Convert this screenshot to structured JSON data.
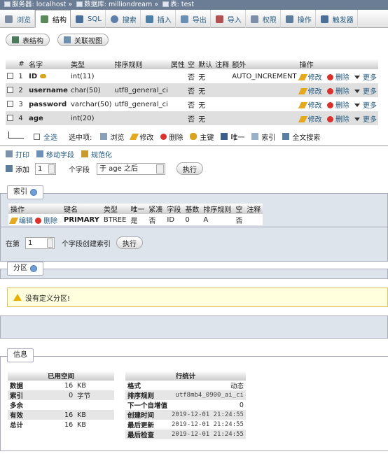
{
  "breadcrumb": {
    "server_label": "服务器:",
    "server": "localhost",
    "db_label": "数据库:",
    "db": "milliondream",
    "table_label": "表:",
    "table": "test",
    "sep": "»"
  },
  "tabs": [
    {
      "label": "浏览",
      "color": "#7d8ca3"
    },
    {
      "label": "结构",
      "color": "#5a8a5a"
    },
    {
      "label": "SQL",
      "color": "#4a6f9a"
    },
    {
      "label": "搜索",
      "color": "#5d7fa8"
    },
    {
      "label": "插入",
      "color": "#4d80a6"
    },
    {
      "label": "导出",
      "color": "#6a8fb5"
    },
    {
      "label": "导入",
      "color": "#b05050"
    },
    {
      "label": "权限",
      "color": "#7f8ea8"
    },
    {
      "label": "操作",
      "color": "#5c7d9c"
    },
    {
      "label": "触发器",
      "color": "#4b6f96"
    }
  ],
  "view_buttons": {
    "table_structure": "表结构",
    "relation_view": "关联视图"
  },
  "columns_header": [
    "#",
    "名字",
    "类型",
    "排序规则",
    "属性",
    "空",
    "默认",
    "注释",
    "额外",
    "操作"
  ],
  "columns": [
    {
      "num": "1",
      "name": "ID",
      "type": "int(11)",
      "collation": "",
      "attr": "",
      "null": "否",
      "default": "无",
      "comment": "",
      "extra": "AUTO_INCREMENT",
      "key_icon": "key-icon"
    },
    {
      "num": "2",
      "name": "username",
      "type": "char(50)",
      "collation": "utf8_general_ci",
      "attr": "",
      "null": "否",
      "default": "无",
      "comment": "",
      "extra": ""
    },
    {
      "num": "3",
      "name": "password",
      "type": "varchar(50)",
      "collation": "utf8_general_ci",
      "attr": "",
      "null": "否",
      "default": "无",
      "comment": "",
      "extra": ""
    },
    {
      "num": "4",
      "name": "age",
      "type": "int(20)",
      "collation": "",
      "attr": "",
      "null": "否",
      "default": "无",
      "comment": "",
      "extra": ""
    }
  ],
  "row_actions": {
    "edit": "修改",
    "delete": "删除",
    "more": "更多"
  },
  "bulk": {
    "select_all": "全选",
    "with_selected": "选中项:",
    "browse": "浏览",
    "edit": "修改",
    "delete": "删除",
    "primary": "主键",
    "unique": "唯一",
    "index": "索引",
    "fulltext": "全文搜索"
  },
  "tools": {
    "print": "打印",
    "move": "移动字段",
    "normalize": "规范化"
  },
  "add_field": {
    "label": "添加",
    "count": "1",
    "unit": "个字段",
    "position": "于 age 之后",
    "execute": "执行"
  },
  "indexes": {
    "legend": "索引",
    "header": [
      "操作",
      "键名",
      "类型",
      "唯一",
      "紧凑",
      "字段",
      "基数",
      "排序规则",
      "空",
      "注释"
    ],
    "rows": [
      {
        "edit": "编辑",
        "delete": "删除",
        "keyname": "PRIMARY",
        "type": "BTREE",
        "unique": "是",
        "packed": "否",
        "column": "ID",
        "cardinality": "0",
        "collation": "A",
        "null": "否",
        "comment": ""
      }
    ],
    "create_prefix": "在第",
    "create_count": "1",
    "create_suffix": "个字段创建索引",
    "execute": "执行"
  },
  "partitions": {
    "legend": "分区",
    "message": "没有定义分区!"
  },
  "info": {
    "legend": "信息",
    "space": {
      "title": "已用空间",
      "rows": [
        {
          "k": "数据",
          "v": "16",
          "u": "KB"
        },
        {
          "k": "索引",
          "v": "0",
          "u": "字节"
        },
        {
          "k": "多余",
          "v": "",
          "u": ""
        },
        {
          "k": "有效",
          "v": "16",
          "u": "KB"
        },
        {
          "k": "总计",
          "v": "16",
          "u": "KB"
        }
      ]
    },
    "rowstats": {
      "title": "行统计",
      "rows": [
        {
          "k": "格式",
          "v": "动态"
        },
        {
          "k": "排序规则",
          "v": "utf8mb4_0900_ai_ci"
        },
        {
          "k": "下一个自增值",
          "v": "0"
        },
        {
          "k": "创建时间",
          "v": "2019-12-01 21:24:55"
        },
        {
          "k": "最后更新",
          "v": "2019-12-01 21:24:55"
        },
        {
          "k": "最后检查",
          "v": "2019-12-01 21:24:55"
        }
      ]
    }
  }
}
